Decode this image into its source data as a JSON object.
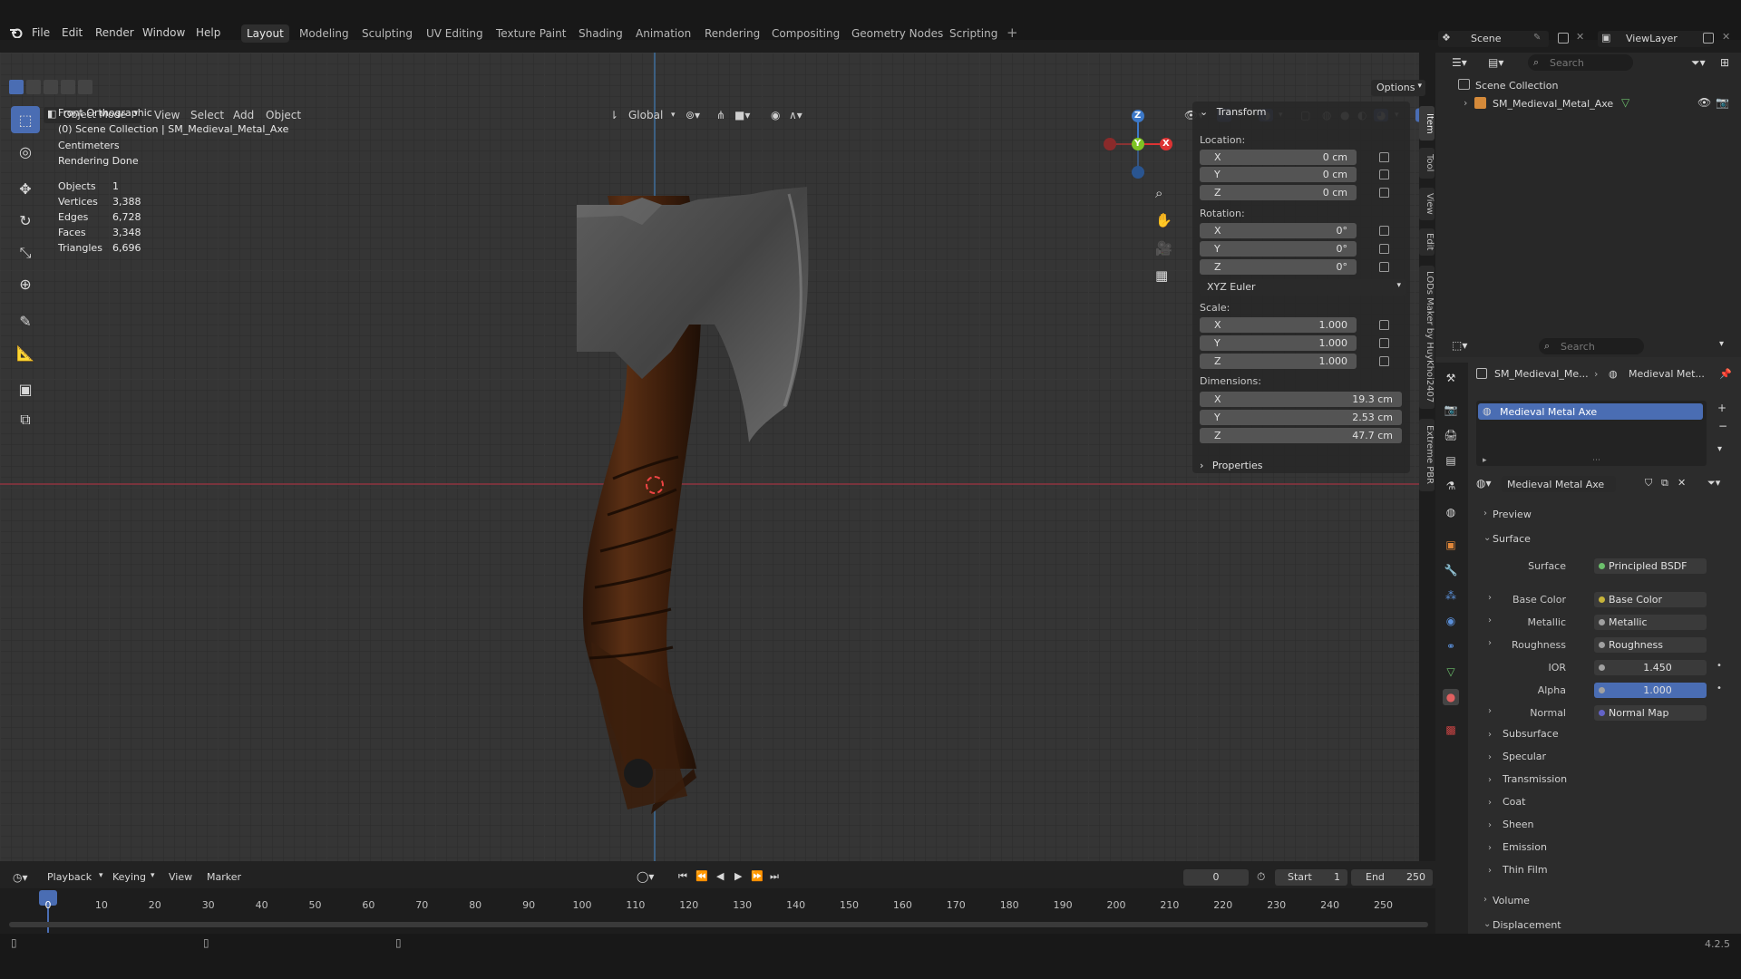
{
  "menus": [
    "File",
    "Edit",
    "Render",
    "Window",
    "Help"
  ],
  "workspaces": [
    "Layout",
    "Modeling",
    "Sculpting",
    "UV Editing",
    "Texture Paint",
    "Shading",
    "Animation",
    "Rendering",
    "Compositing",
    "Geometry Nodes",
    "Scripting"
  ],
  "active_workspace": "Layout",
  "scene": {
    "name": "Scene",
    "view_layer": "ViewLayer"
  },
  "viewport_header": {
    "mode": "Object Mode",
    "view": "View",
    "select": "Select",
    "add": "Add",
    "object": "Object",
    "orientation": "Global",
    "options": "Options"
  },
  "overlay": {
    "view_name": "Front Orthographic",
    "collection": "(0) Scene Collection | SM_Medieval_Metal_Axe",
    "units": "Centimeters",
    "status": "Rendering Done",
    "stats": [
      {
        "label": "Objects",
        "value": "1"
      },
      {
        "label": "Vertices",
        "value": "3,388"
      },
      {
        "label": "Edges",
        "value": "6,728"
      },
      {
        "label": "Faces",
        "value": "3,348"
      },
      {
        "label": "Triangles",
        "value": "6,696"
      }
    ]
  },
  "gizmo": {
    "z": "Z",
    "y": "Y",
    "x": "X"
  },
  "transform": {
    "title": "Transform",
    "location_label": "Location:",
    "rotation_label": "Rotation:",
    "scale_label": "Scale:",
    "dimensions_label": "Dimensions:",
    "location": [
      {
        "axis": "X",
        "value": "0 cm"
      },
      {
        "axis": "Y",
        "value": "0 cm"
      },
      {
        "axis": "Z",
        "value": "0 cm"
      }
    ],
    "rotation": [
      {
        "axis": "X",
        "value": "0°"
      },
      {
        "axis": "Y",
        "value": "0°"
      },
      {
        "axis": "Z",
        "value": "0°"
      }
    ],
    "rotation_mode": "XYZ Euler",
    "scale": [
      {
        "axis": "X",
        "value": "1.000"
      },
      {
        "axis": "Y",
        "value": "1.000"
      },
      {
        "axis": "Z",
        "value": "1.000"
      }
    ],
    "dimensions": [
      {
        "axis": "X",
        "value": "19.3 cm"
      },
      {
        "axis": "Y",
        "value": "2.53 cm"
      },
      {
        "axis": "Z",
        "value": "47.7 cm"
      }
    ],
    "properties": "Properties"
  },
  "side_tabs": [
    "Item",
    "Tool",
    "View",
    "Edit",
    "LODs Maker by HuyKhoi2407",
    "Extreme PBR"
  ],
  "outliner": {
    "search_placeholder": "Search",
    "root": "Scene Collection",
    "object": "SM_Medieval_Metal_Axe"
  },
  "properties": {
    "search_placeholder": "Search",
    "breadcrumb_object": "SM_Medieval_Me...",
    "breadcrumb_material": "Medieval Met...",
    "slot": "Medieval Metal Axe",
    "material_name": "Medieval Metal Axe",
    "preview": "Preview",
    "surface_section": "Surface",
    "surface": {
      "label": "Surface",
      "value": "Principled BSDF"
    },
    "inputs": [
      {
        "label": "Base Color",
        "value": "Base Color",
        "dot": "#c7b43a",
        "expand": true
      },
      {
        "label": "Metallic",
        "value": "Metallic",
        "dot": "#a0a0a0",
        "expand": true
      },
      {
        "label": "Roughness",
        "value": "Roughness",
        "dot": "#a0a0a0",
        "expand": true
      },
      {
        "label": "IOR",
        "value": "1.450",
        "dot": "#a0a0a0",
        "expand": false
      },
      {
        "label": "Alpha",
        "value": "1.000",
        "dot": "#a0a0a0",
        "expand": false,
        "active": true
      },
      {
        "label": "Normal",
        "value": "Normal Map",
        "dot": "#6363c7",
        "expand": true
      }
    ],
    "subsections": [
      "Subsurface",
      "Specular",
      "Transmission",
      "Coat",
      "Sheen",
      "Emission",
      "Thin Film"
    ],
    "volume": "Volume",
    "displacement": "Displacement"
  },
  "timeline": {
    "menus": [
      "Playback",
      "Keying",
      "View",
      "Marker"
    ],
    "current_frame": "0",
    "start_label": "Start",
    "start": "1",
    "end_label": "End",
    "end": "250",
    "ticks": [
      "0",
      "10",
      "20",
      "30",
      "40",
      "50",
      "60",
      "70",
      "80",
      "90",
      "100",
      "110",
      "120",
      "130",
      "140",
      "150",
      "160",
      "170",
      "180",
      "190",
      "200",
      "210",
      "220",
      "230",
      "240",
      "250"
    ]
  },
  "version": "4.2.5"
}
